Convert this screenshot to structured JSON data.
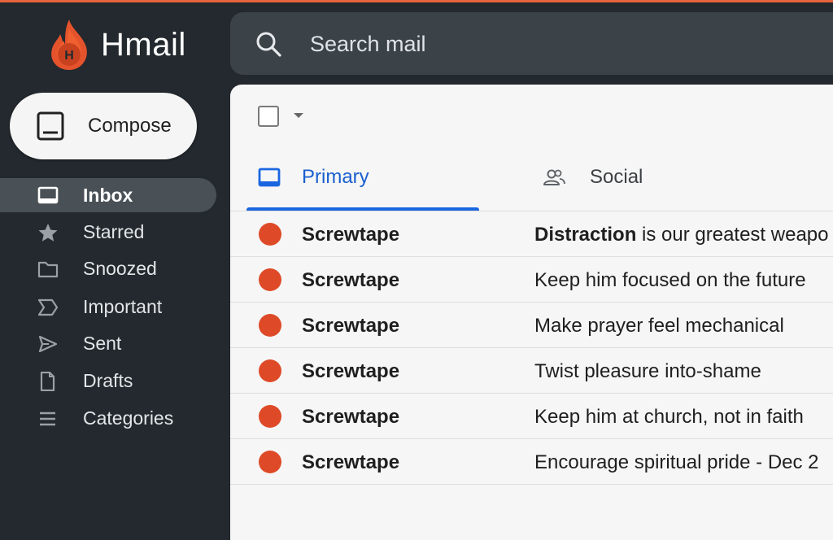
{
  "app": {
    "name": "Hmail",
    "logo_letter": "H",
    "accent_color": "#e5643b"
  },
  "search": {
    "placeholder": "Search mail",
    "value": ""
  },
  "compose": {
    "label": "Compose"
  },
  "sidebar": {
    "items": [
      {
        "label": "Inbox",
        "icon": "inbox-icon",
        "active": true
      },
      {
        "label": "Starred",
        "icon": "star-icon"
      },
      {
        "label": "Snoozed",
        "icon": "folder-icon"
      },
      {
        "label": "Important",
        "icon": "important-icon"
      },
      {
        "label": "Sent",
        "icon": "send-icon"
      },
      {
        "label": "Drafts",
        "icon": "draft-icon"
      },
      {
        "label": "Categories",
        "icon": "menu-icon"
      }
    ]
  },
  "tabs": [
    {
      "label": "Primary",
      "icon": "inbox-icon",
      "active": true,
      "color": "#1a66e0"
    },
    {
      "label": "Social",
      "icon": "people-icon"
    }
  ],
  "emails": [
    {
      "sender": "Screwtape",
      "subject_bold": "Distraction",
      "subject_rest": " is our greatest weapo"
    },
    {
      "sender": "Screwtape",
      "subject_bold": "",
      "subject_rest": "Keep him focused on the future"
    },
    {
      "sender": "Screwtape",
      "subject_bold": "",
      "subject_rest": "Make prayer feel mechanical"
    },
    {
      "sender": "Screwtape",
      "subject_bold": "",
      "subject_rest": "Twist pleasure into-shame"
    },
    {
      "sender": "Screwtape",
      "subject_bold": "",
      "subject_rest": "Keep him at church, not in faith"
    },
    {
      "sender": "Screwtape",
      "subject_bold": "",
      "subject_rest": "Encourage spiritual pride - Dec 2"
    }
  ],
  "colors": {
    "unread_dot": "#de4a27",
    "sidebar_bg": "#23292e",
    "main_bg": "#f6f6f6"
  }
}
